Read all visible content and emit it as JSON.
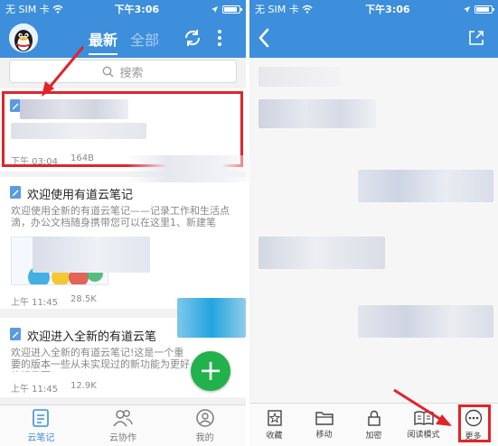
{
  "status_bar": {
    "carrier": "无 SIM 卡",
    "time": "下午3:06",
    "battery_level": 0.8
  },
  "list_screen": {
    "tabs": {
      "latest": "最新",
      "all": "全部"
    },
    "search_placeholder": "搜索",
    "notes": [
      {
        "title": "",
        "snippet": "",
        "time": "下午 03:04",
        "size": "164B"
      },
      {
        "title": "欢迎使用有道云笔记",
        "snippet": "欢迎使用全新的有道云笔记——记录工作和生活点滴，办公文档随身携带您可以在这里1、新建笔",
        "time": "上午 11:45",
        "size": "28.5K"
      },
      {
        "title": "欢迎进入全新的有道云笔",
        "snippet": "欢迎进入全新的有道云笔记!这是一个重要的版本一些从未实现过的新功能为更好的记录更",
        "time": "上午 11:45",
        "size": "12.9K"
      }
    ],
    "fab_label": "+",
    "bottom_tabs": [
      {
        "label": "云笔记",
        "icon": "note-icon"
      },
      {
        "label": "云协作",
        "icon": "people-icon"
      },
      {
        "label": "我的",
        "icon": "profile-icon"
      }
    ]
  },
  "detail_screen": {
    "toolbar": [
      {
        "label": "收藏",
        "icon": "star-icon"
      },
      {
        "label": "移动",
        "icon": "folder-icon"
      },
      {
        "label": "加密",
        "icon": "lock-icon"
      },
      {
        "label": "阅读模式",
        "icon": "book-icon"
      },
      {
        "label": "更多",
        "icon": "more-icon"
      }
    ]
  },
  "colors": {
    "brand_blue": "#3d8fdb",
    "highlight_red": "#e0242b",
    "fab_green": "#21b24b"
  }
}
